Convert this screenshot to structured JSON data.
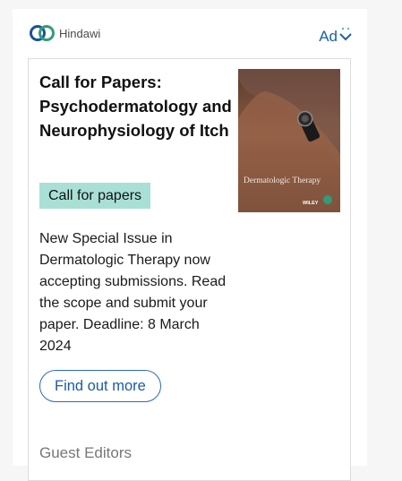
{
  "brand": {
    "name": "Hindawi"
  },
  "adchoice": {
    "label": "Ad"
  },
  "card": {
    "title": "Call for Papers: Psychodermatology and Neurophysiology of Itch",
    "tag": "Call for papers",
    "description": "New Special Issue in Dermatologic Therapy now accepting submissions. Read the scope and submit your paper. Deadline: 8 March 2024",
    "cta": "Find out more",
    "section_label": "Guest Editors",
    "cover": {
      "title": "Dermatologic Therapy",
      "publisher": "WILEY"
    }
  },
  "colors": {
    "accent": "#1c5aa6",
    "tag_bg": "#a8e0d6",
    "logo_green": "#2e9c7d",
    "logo_blue": "#1c4fa0"
  }
}
